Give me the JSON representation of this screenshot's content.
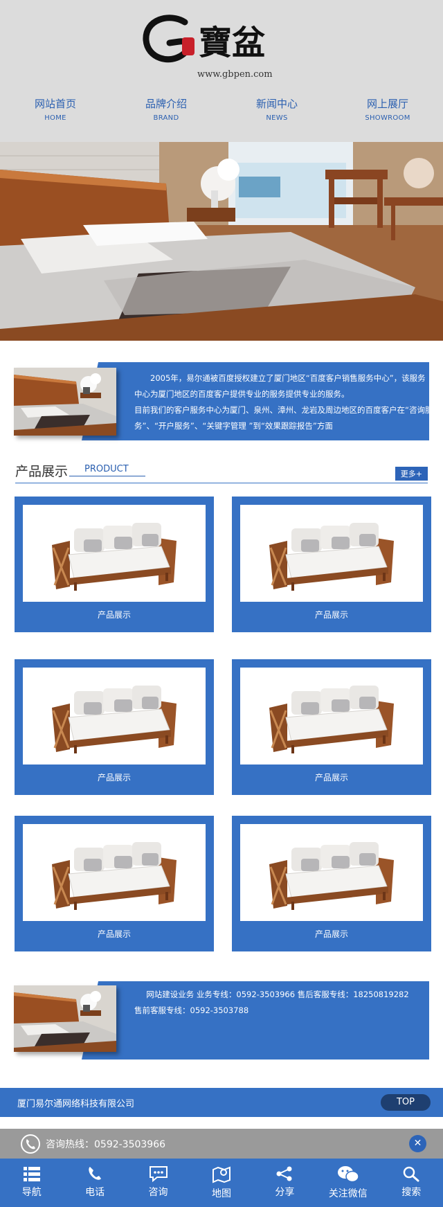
{
  "header": {
    "logo_url_text": "www.gbpen.com",
    "logo_text": "G寶盆"
  },
  "nav": [
    {
      "cn": "网站首页",
      "en": "HOME"
    },
    {
      "cn": "品牌介绍",
      "en": "BRAND"
    },
    {
      "cn": "新闻中心",
      "en": "NEWS"
    },
    {
      "cn": "网上展厅",
      "en": "SHOWROOM"
    }
  ],
  "intro": {
    "p1": "2005年，易尔通被百度授权建立了厦门地区“百度客户销售服务中心”，该服务中心为厦门地区的百度客户提供专业的服务提供专业的服务。",
    "p2": "目前我们的客户服务中心为厦门、泉州、漳州、龙岩及周边地区的百度客户在“咨询服务”、“开户服务”、“关键字管理 ”到“效果跟踪报告”方面"
  },
  "products": {
    "title_cn": "产品展示",
    "title_en": "PRODUCT",
    "more": "更多+",
    "items": [
      {
        "caption": "产品展示"
      },
      {
        "caption": "产品展示"
      },
      {
        "caption": "产品展示"
      },
      {
        "caption": "产品展示"
      },
      {
        "caption": "产品展示"
      },
      {
        "caption": "产品展示"
      }
    ]
  },
  "contact": {
    "line1": "网站建设业务  业务专线：0592-3503966 售后客服专线：18250819282",
    "line2": "售前客服专线：0592-3503788"
  },
  "footer": {
    "company": "厦门易尔通网络科技有限公司",
    "top": "TOP",
    "hotline": "咨询热线：0592-3503966",
    "close": "✕"
  },
  "tabbar": [
    {
      "label": "导航",
      "icon": "menu-icon"
    },
    {
      "label": "电话",
      "icon": "phone-icon"
    },
    {
      "label": "咨询",
      "icon": "chat-icon"
    },
    {
      "label": "地图",
      "icon": "map-icon"
    },
    {
      "label": "分享",
      "icon": "share-icon"
    },
    {
      "label": "关注微信",
      "icon": "wechat-icon"
    },
    {
      "label": "搜索",
      "icon": "search-icon"
    }
  ],
  "colors": {
    "primary": "#3671c4",
    "header_bg": "#dcdcdc",
    "hotline_bg": "#9a9a9a",
    "nav_text": "#2a5fb0"
  }
}
